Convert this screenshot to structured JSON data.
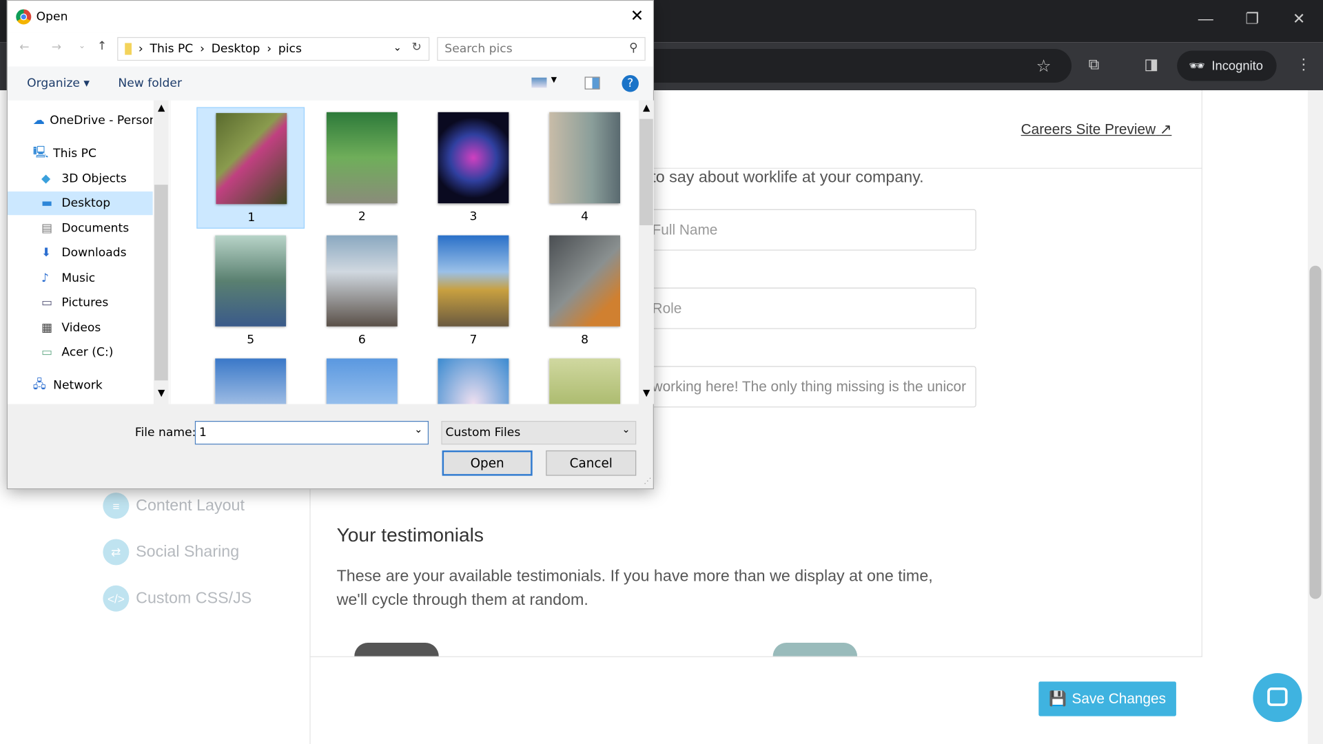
{
  "browser": {
    "incognito_label": "Incognito"
  },
  "page": {
    "careers_link": "Careers Site Preview",
    "intro_text": "to say about worklife at your company.",
    "full_name_placeholder": "Full Name",
    "role_placeholder": "Role",
    "quote_value": "working here! The only thing missing is the unicor",
    "nav": [
      {
        "label": "Content Layout",
        "icon": "list-icon"
      },
      {
        "label": "Social Sharing",
        "icon": "share-icon"
      },
      {
        "label": "Custom CSS/JS",
        "icon": "code-icon"
      }
    ],
    "testimonials_title": "Your testimonials",
    "testimonials_desc": "These are your available testimonials. If you have more than we display at one time, we'll cycle through them at random.",
    "save_label": "Save Changes",
    "accent": "#3fb3e0"
  },
  "dialog": {
    "title": "Open",
    "breadcrumb": [
      "This PC",
      "Desktop",
      "pics"
    ],
    "search_placeholder": "Search pics",
    "organize_label": "Organize ▾",
    "new_folder_label": "New folder",
    "tree": [
      {
        "label": "OneDrive - Person",
        "icon": "cloud-icon"
      },
      {
        "label": "This PC",
        "icon": "computer-icon"
      },
      {
        "label": "3D Objects",
        "icon": "cube-icon"
      },
      {
        "label": "Desktop",
        "icon": "desktop-icon",
        "selected": true
      },
      {
        "label": "Documents",
        "icon": "document-icon"
      },
      {
        "label": "Downloads",
        "icon": "download-icon"
      },
      {
        "label": "Music",
        "icon": "music-icon"
      },
      {
        "label": "Pictures",
        "icon": "picture-icon"
      },
      {
        "label": "Videos",
        "icon": "video-icon"
      },
      {
        "label": "Acer (C:)",
        "icon": "drive-icon"
      },
      {
        "label": "Network",
        "icon": "network-icon"
      }
    ],
    "files": [
      {
        "label": "1",
        "selected": true
      },
      {
        "label": "2"
      },
      {
        "label": "3"
      },
      {
        "label": "4"
      },
      {
        "label": "5"
      },
      {
        "label": "6"
      },
      {
        "label": "7"
      },
      {
        "label": "8"
      },
      {
        "label": ""
      },
      {
        "label": ""
      },
      {
        "label": ""
      },
      {
        "label": ""
      }
    ],
    "file_name_label": "File name:",
    "file_name_value": "1",
    "file_type": "Custom Files",
    "open_label": "Open",
    "cancel_label": "Cancel"
  }
}
